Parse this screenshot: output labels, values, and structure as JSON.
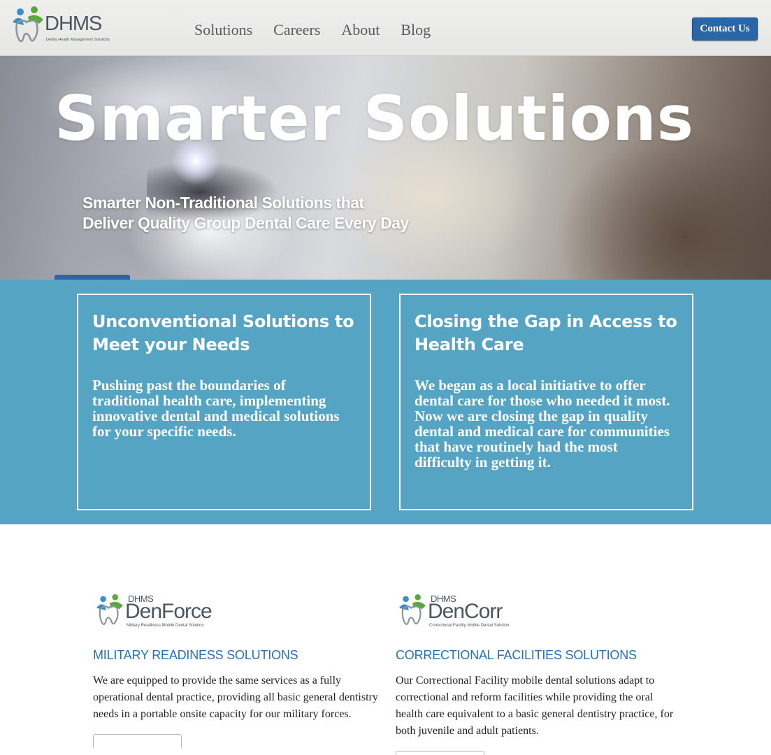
{
  "header": {
    "logo_text": "DHMS",
    "logo_subtitle": "Dental Health Management Solutions",
    "nav": [
      "Solutions",
      "Careers",
      "About",
      "Blog"
    ],
    "contact_label": "Contact Us"
  },
  "hero": {
    "title": "Smarter Solutions",
    "subtitle_line1": "Smarter Non-Traditional Solutions that",
    "subtitle_line2": "Deliver Quality Group Dental Care Every Day"
  },
  "cards": [
    {
      "title": "Unconventional Solutions to Meet your Needs",
      "body": "Pushing past the boundaries of traditional health care, implementing innovative dental and medical solutions for your specific needs."
    },
    {
      "title": "Closing the Gap in Access to Health Care",
      "body": "We began as a local initiative to offer dental care for those who needed it most. Now we are closing the gap in quality dental and medical care for communities that have routinely had the most difficulty in getting it."
    }
  ],
  "products": [
    {
      "logo_brand": "DHMS",
      "logo_name": "DenForce",
      "logo_tagline": "Military Readiness Mobile Dental Solution",
      "heading": "MILITARY READINESS SOLUTIONS",
      "body": "We are equipped to provide the same services as a fully operational dental practice, providing all basic general dentistry needs in a portable onsite capacity for our military forces."
    },
    {
      "logo_brand": "DHMS",
      "logo_name": "DenCorr",
      "logo_tagline": "Correctional Facility Mobile Dental Solution",
      "heading": "CORRECTIONAL FACILITIES SOLUTIONS",
      "body": "Our Correctional Facility mobile dental solutions adapt to correctional and reform facilities while providing the oral health care equivalent to a basic general dentistry practice, for both juvenile and adult patients."
    }
  ],
  "colors": {
    "accent_blue": "#2a66a6",
    "band_blue": "#55a4c3",
    "heading_blue": "#2a6fb0",
    "logo_green": "#5aa83c",
    "logo_blue": "#3a8fc8"
  },
  "icons": [
    "dhms-tooth-people-logo-icon"
  ]
}
